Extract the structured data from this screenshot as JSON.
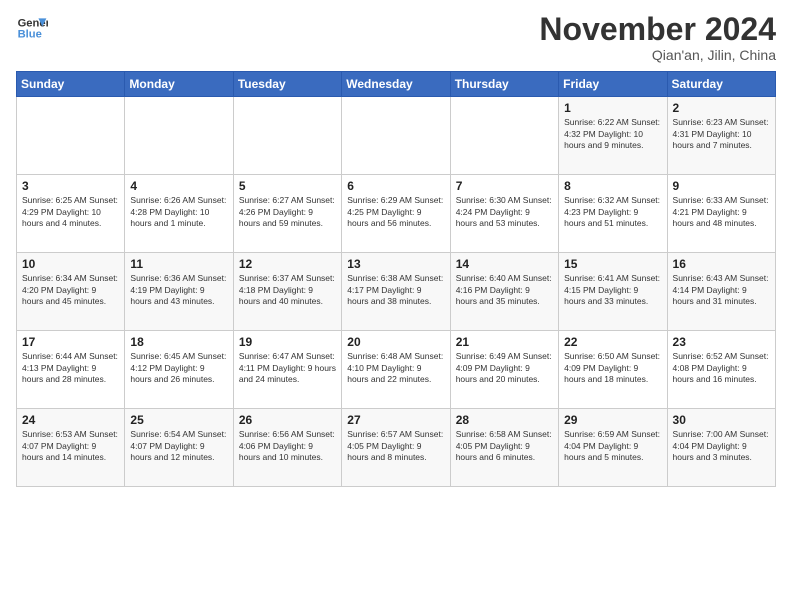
{
  "logo": {
    "line1": "General",
    "line2": "Blue"
  },
  "title": "November 2024",
  "subtitle": "Qian'an, Jilin, China",
  "weekdays": [
    "Sunday",
    "Monday",
    "Tuesday",
    "Wednesday",
    "Thursday",
    "Friday",
    "Saturday"
  ],
  "weeks": [
    [
      {
        "day": "",
        "info": ""
      },
      {
        "day": "",
        "info": ""
      },
      {
        "day": "",
        "info": ""
      },
      {
        "day": "",
        "info": ""
      },
      {
        "day": "",
        "info": ""
      },
      {
        "day": "1",
        "info": "Sunrise: 6:22 AM\nSunset: 4:32 PM\nDaylight: 10 hours and 9 minutes."
      },
      {
        "day": "2",
        "info": "Sunrise: 6:23 AM\nSunset: 4:31 PM\nDaylight: 10 hours and 7 minutes."
      }
    ],
    [
      {
        "day": "3",
        "info": "Sunrise: 6:25 AM\nSunset: 4:29 PM\nDaylight: 10 hours and 4 minutes."
      },
      {
        "day": "4",
        "info": "Sunrise: 6:26 AM\nSunset: 4:28 PM\nDaylight: 10 hours and 1 minute."
      },
      {
        "day": "5",
        "info": "Sunrise: 6:27 AM\nSunset: 4:26 PM\nDaylight: 9 hours and 59 minutes."
      },
      {
        "day": "6",
        "info": "Sunrise: 6:29 AM\nSunset: 4:25 PM\nDaylight: 9 hours and 56 minutes."
      },
      {
        "day": "7",
        "info": "Sunrise: 6:30 AM\nSunset: 4:24 PM\nDaylight: 9 hours and 53 minutes."
      },
      {
        "day": "8",
        "info": "Sunrise: 6:32 AM\nSunset: 4:23 PM\nDaylight: 9 hours and 51 minutes."
      },
      {
        "day": "9",
        "info": "Sunrise: 6:33 AM\nSunset: 4:21 PM\nDaylight: 9 hours and 48 minutes."
      }
    ],
    [
      {
        "day": "10",
        "info": "Sunrise: 6:34 AM\nSunset: 4:20 PM\nDaylight: 9 hours and 45 minutes."
      },
      {
        "day": "11",
        "info": "Sunrise: 6:36 AM\nSunset: 4:19 PM\nDaylight: 9 hours and 43 minutes."
      },
      {
        "day": "12",
        "info": "Sunrise: 6:37 AM\nSunset: 4:18 PM\nDaylight: 9 hours and 40 minutes."
      },
      {
        "day": "13",
        "info": "Sunrise: 6:38 AM\nSunset: 4:17 PM\nDaylight: 9 hours and 38 minutes."
      },
      {
        "day": "14",
        "info": "Sunrise: 6:40 AM\nSunset: 4:16 PM\nDaylight: 9 hours and 35 minutes."
      },
      {
        "day": "15",
        "info": "Sunrise: 6:41 AM\nSunset: 4:15 PM\nDaylight: 9 hours and 33 minutes."
      },
      {
        "day": "16",
        "info": "Sunrise: 6:43 AM\nSunset: 4:14 PM\nDaylight: 9 hours and 31 minutes."
      }
    ],
    [
      {
        "day": "17",
        "info": "Sunrise: 6:44 AM\nSunset: 4:13 PM\nDaylight: 9 hours and 28 minutes."
      },
      {
        "day": "18",
        "info": "Sunrise: 6:45 AM\nSunset: 4:12 PM\nDaylight: 9 hours and 26 minutes."
      },
      {
        "day": "19",
        "info": "Sunrise: 6:47 AM\nSunset: 4:11 PM\nDaylight: 9 hours and 24 minutes."
      },
      {
        "day": "20",
        "info": "Sunrise: 6:48 AM\nSunset: 4:10 PM\nDaylight: 9 hours and 22 minutes."
      },
      {
        "day": "21",
        "info": "Sunrise: 6:49 AM\nSunset: 4:09 PM\nDaylight: 9 hours and 20 minutes."
      },
      {
        "day": "22",
        "info": "Sunrise: 6:50 AM\nSunset: 4:09 PM\nDaylight: 9 hours and 18 minutes."
      },
      {
        "day": "23",
        "info": "Sunrise: 6:52 AM\nSunset: 4:08 PM\nDaylight: 9 hours and 16 minutes."
      }
    ],
    [
      {
        "day": "24",
        "info": "Sunrise: 6:53 AM\nSunset: 4:07 PM\nDaylight: 9 hours and 14 minutes."
      },
      {
        "day": "25",
        "info": "Sunrise: 6:54 AM\nSunset: 4:07 PM\nDaylight: 9 hours and 12 minutes."
      },
      {
        "day": "26",
        "info": "Sunrise: 6:56 AM\nSunset: 4:06 PM\nDaylight: 9 hours and 10 minutes."
      },
      {
        "day": "27",
        "info": "Sunrise: 6:57 AM\nSunset: 4:05 PM\nDaylight: 9 hours and 8 minutes."
      },
      {
        "day": "28",
        "info": "Sunrise: 6:58 AM\nSunset: 4:05 PM\nDaylight: 9 hours and 6 minutes."
      },
      {
        "day": "29",
        "info": "Sunrise: 6:59 AM\nSunset: 4:04 PM\nDaylight: 9 hours and 5 minutes."
      },
      {
        "day": "30",
        "info": "Sunrise: 7:00 AM\nSunset: 4:04 PM\nDaylight: 9 hours and 3 minutes."
      }
    ]
  ]
}
